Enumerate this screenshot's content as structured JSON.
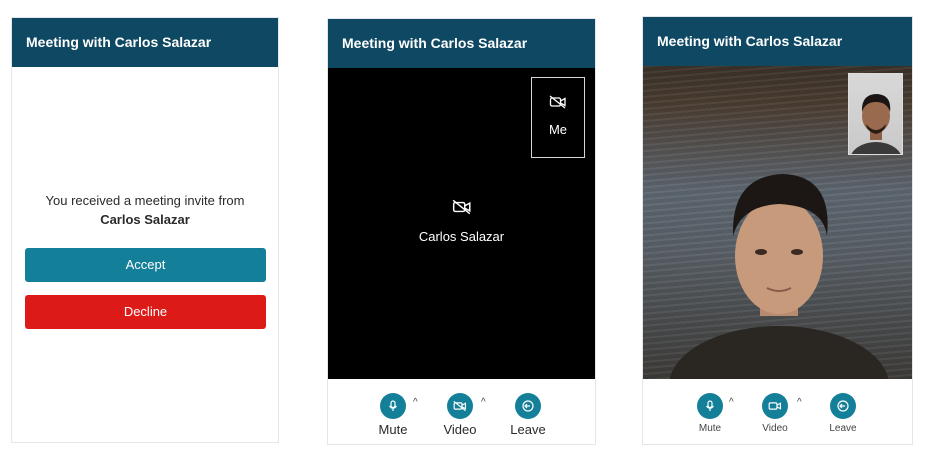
{
  "meeting_title": "Meeting with Carlos Salazar",
  "invite": {
    "message": "You received a meeting invite from",
    "caller": "Carlos Salazar",
    "accept_label": "Accept",
    "decline_label": "Decline"
  },
  "call": {
    "self_label": "Me",
    "remote_name": "Carlos Salazar"
  },
  "controls": {
    "mute": "Mute",
    "video": "Video",
    "leave": "Leave"
  },
  "icons": {
    "mute": "microphone-icon",
    "video": "video-camera-icon",
    "video_off": "video-off-icon",
    "leave": "leave-icon",
    "options": "caret-up-icon"
  },
  "colors": {
    "header": "#0e4863",
    "accept": "#147f98",
    "decline": "#dc1b18",
    "control": "#147f98"
  }
}
